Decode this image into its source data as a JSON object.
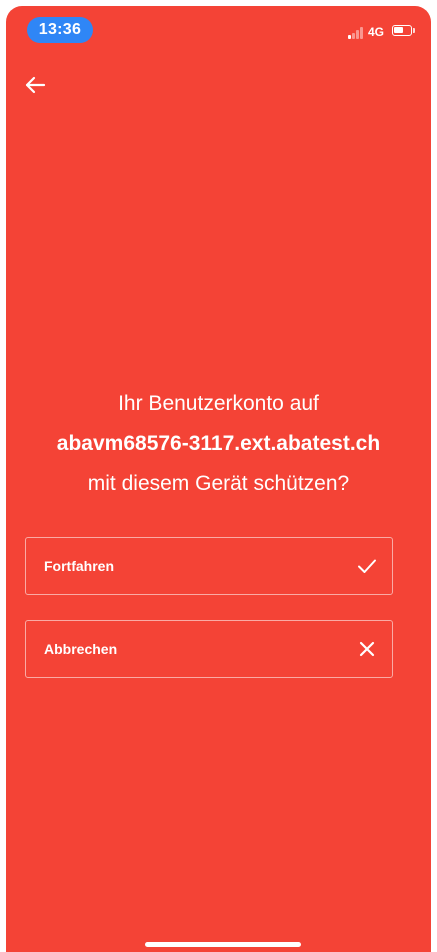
{
  "status_bar": {
    "time": "13:36",
    "network": "4G",
    "signal_bars_active": 1,
    "signal_bars_total": 4,
    "battery_level": 0.6,
    "icons": [
      "signal-icon",
      "battery-icon"
    ]
  },
  "header": {
    "back_icon": "arrow-left-icon"
  },
  "message": {
    "line1": "Ihr Benutzerkonto auf",
    "host": "abavm68576-3117.ext.abatest.ch",
    "line3": "mit diesem Gerät schützen?"
  },
  "actions": {
    "continue_label": "Fortfahren",
    "continue_icon": "checkmark-icon",
    "cancel_label": "Abbrechen",
    "cancel_icon": "close-icon"
  },
  "colors": {
    "background": "#f44336",
    "accent_time_pill": "#2f86f6",
    "text": "#ffffff"
  }
}
